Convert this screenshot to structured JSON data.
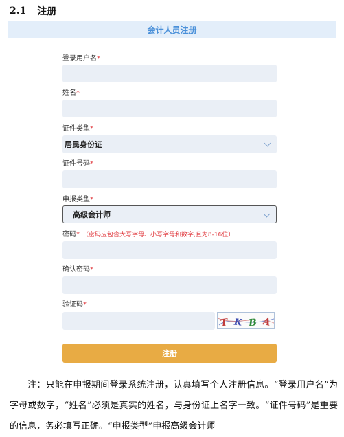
{
  "section": {
    "number": "2.1",
    "title": "注册"
  },
  "form": {
    "title": "会计人员注册",
    "required_mark": "*",
    "fields": {
      "username": {
        "label": "登录用户名"
      },
      "name": {
        "label": "姓名"
      },
      "id_type": {
        "label": "证件类型",
        "value": "居民身份证"
      },
      "id_number": {
        "label": "证件号码"
      },
      "apply_type": {
        "label": "申报类型",
        "value": "高级会计师"
      },
      "password": {
        "label": "密码",
        "hint": "（密码应包含大写字母、小写字母和数字,且为8-16位）"
      },
      "confirm_password": {
        "label": "确认密码"
      },
      "captcha": {
        "label": "验证码",
        "image_text": "TKBA"
      }
    },
    "submit_label": "注册"
  },
  "note": "注：只能在申报期间登录系统注册，认真填写个人注册信息。“登录用户名”为字母或数字，“姓名”必须是真实的姓名，与身份证上名字一致。“证件号码”是重要的信息，务必填写正确。“申报类型”申报高级会计师"
}
